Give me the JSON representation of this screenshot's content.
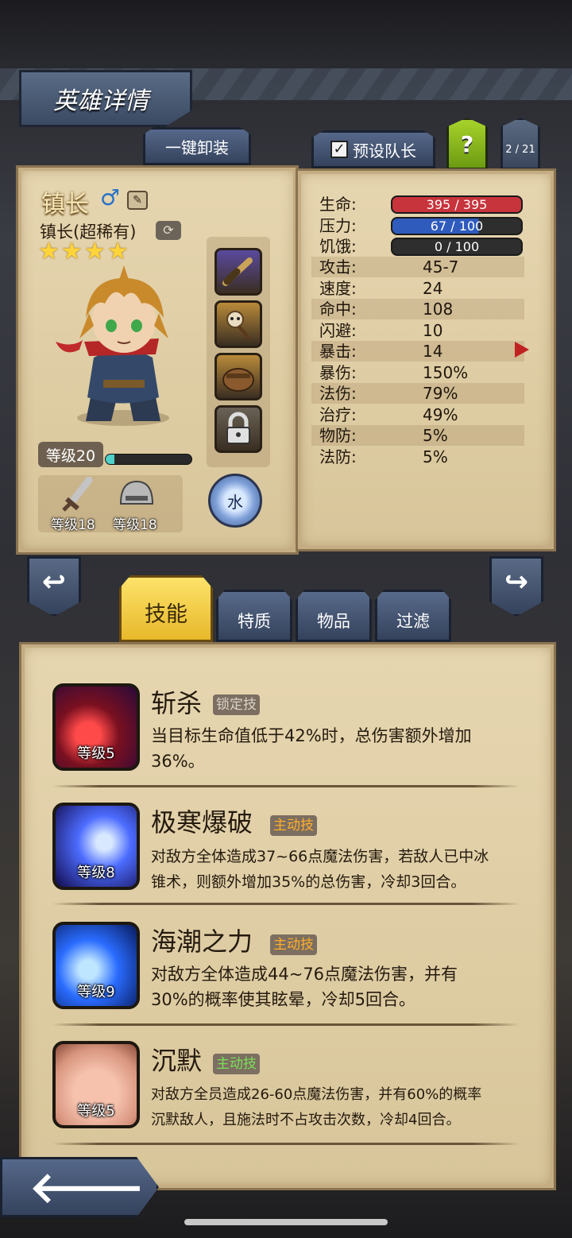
{
  "header": {
    "title": "英雄详情"
  },
  "toolbar": {
    "unequip_all": "一键卸装",
    "preset_leader": "预设队长",
    "preset_leader_checked": true,
    "help": "?",
    "page_counter": "2 / 21"
  },
  "hero": {
    "name": "镇长",
    "class": "镇长(超稀有)",
    "stars": 4,
    "level_label": "等级20",
    "xp_fraction": 0.1,
    "gender_icon": "male-icon",
    "element": "水",
    "items": [
      {
        "icon": "spyglass-icon",
        "color": "#5a4a9e"
      },
      {
        "icon": "skull-staff-icon",
        "color": "#b98a3a"
      },
      {
        "icon": "treasure-bag-icon",
        "color": "#b98a3a"
      },
      {
        "icon": "lock-icon",
        "color": "#6a6256"
      }
    ],
    "equipment": [
      {
        "icon": "sword-icon",
        "level": "等级18"
      },
      {
        "icon": "helmet-icon",
        "level": "等级18"
      }
    ]
  },
  "stats": {
    "bars": [
      {
        "label": "生命:",
        "value": "395 / 395",
        "fraction": 1.0,
        "color": "#c8343c"
      },
      {
        "label": "压力:",
        "value": "67 / 100",
        "fraction": 0.67,
        "color": "#2f5bbd"
      },
      {
        "label": "饥饿:",
        "value": "0 / 100",
        "fraction": 0.0,
        "color": "#3a3a3a"
      }
    ],
    "rows": [
      {
        "label": "攻击:",
        "value": "45-7"
      },
      {
        "label": "速度:",
        "value": "24"
      },
      {
        "label": "命中:",
        "value": "108"
      },
      {
        "label": "闪避:",
        "value": "10"
      },
      {
        "label": "暴击:",
        "value": "14"
      },
      {
        "label": "暴伤:",
        "value": "150%"
      },
      {
        "label": "法伤:",
        "value": "79%"
      },
      {
        "label": "治疗:",
        "value": "49%"
      },
      {
        "label": "物防:",
        "value": "5%"
      },
      {
        "label": "法防:",
        "value": "5%"
      }
    ]
  },
  "tabs": [
    {
      "label": "技能",
      "active": true
    },
    {
      "label": "特质",
      "active": false
    },
    {
      "label": "物品",
      "active": false
    },
    {
      "label": "过滤",
      "active": false
    }
  ],
  "skills": [
    {
      "name": "斩杀",
      "tag": "锁定技",
      "tag_color": "#d9d3c8",
      "level": "等级5",
      "icon": "slash-icon",
      "desc_line1": "当目标生命值低于42%时，总伤害额外增加",
      "desc_line2": "36%。"
    },
    {
      "name": "极寒爆破",
      "tag": "主动技",
      "tag_color": "#ffae2c",
      "level": "等级8",
      "icon": "ice-spike-icon",
      "desc_line1": "对敌方全体造成37~66点魔法伤害，若敌人已中冰",
      "desc_line2": "锥术，则额外增加35%的总伤害，冷却3回合。"
    },
    {
      "name": "海潮之力",
      "tag": "主动技",
      "tag_color": "#ffae2c",
      "level": "等级9",
      "icon": "tide-icon",
      "desc_line1": "对敌方全体造成44~76点魔法伤害，并有",
      "desc_line2": "30%的概率使其眩晕，冷却5回合。"
    },
    {
      "name": "沉默",
      "tag": "主动技",
      "tag_color": "#7be05a",
      "level": "等级5",
      "icon": "silence-icon",
      "desc_line1": "对敌方全员造成26-60点魔法伤害，并有60%的概率",
      "desc_line2": "沉默敌人，且施法时不占攻击次数，冷却4回合。"
    }
  ],
  "nav": {
    "prev": "↩",
    "next": "↪",
    "back": "🡐"
  }
}
